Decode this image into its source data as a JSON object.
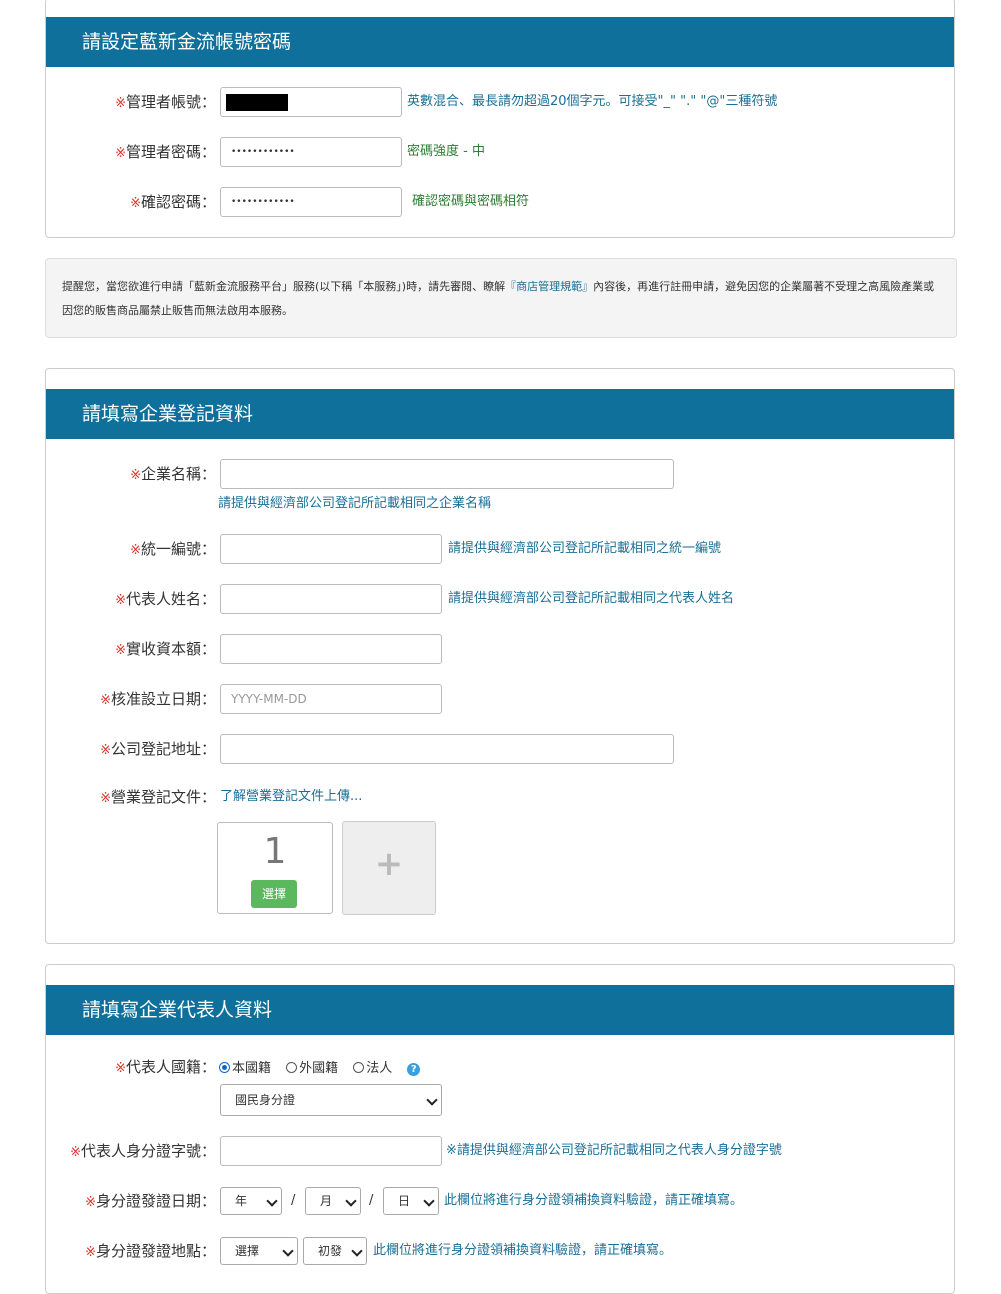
{
  "account_section": {
    "title": "請設定藍新金流帳號密碼",
    "admin_account": {
      "label": "管理者帳號：",
      "hint": "英數混合、最長請勿超過20個字元。可接受\"_\" \".\" \"@\"三種符號"
    },
    "admin_password": {
      "label": "管理者密碼：",
      "value": "••••••••••••",
      "strength": "密碼強度 - 中"
    },
    "confirm_password": {
      "label": "確認密碼：",
      "value": "••••••••••••",
      "match": "確認密碼與密碼相符"
    }
  },
  "notice": {
    "text_before": "提醒您，當您欲進行申請「藍新金流服務平台」服務(以下稱「本服務」)時，請先審閱、瞭解",
    "link": "『商店管理規範』",
    "text_after": "內容後，再進行註冊申請，避免因您的企業屬著不受理之高風險產業或因您的販售商品屬禁止販售而無法啟用本服務。"
  },
  "company_section": {
    "title": "請填寫企業登記資料",
    "company_name": {
      "label": "企業名稱：",
      "hint": "請提供與經濟部公司登記所記載相同之企業名稱"
    },
    "tax_id": {
      "label": "統一編號：",
      "hint": "請提供與經濟部公司登記所記載相同之統一編號"
    },
    "rep_name": {
      "label": "代表人姓名：",
      "hint": "請提供與經濟部公司登記所記載相同之代表人姓名"
    },
    "capital": {
      "label": "實收資本額："
    },
    "est_date": {
      "label": "核准設立日期：",
      "placeholder": "YYYY-MM-DD"
    },
    "address": {
      "label": "公司登記地址："
    },
    "business_doc": {
      "label": "營業登記文件：",
      "link": "了解營業登記文件上傳..."
    },
    "upload_slot": {
      "number": "1",
      "button": "選擇",
      "add": "+"
    }
  },
  "rep_section": {
    "title": "請填寫企業代表人資料",
    "nationality": {
      "label": "代表人國籍：",
      "options": [
        "本國籍",
        "外國籍",
        "法人"
      ],
      "selected": "本國籍"
    },
    "id_type": {
      "value": "國民身分證"
    },
    "id_number": {
      "label": "代表人身分證字號：",
      "hint": "※請提供與經濟部公司登記所記載相同之代表人身分證字號"
    },
    "issue_date": {
      "label": "身分證發證日期：",
      "year": "年",
      "month": "月",
      "day": "日",
      "sep": "/",
      "hint": "此欄位將進行身分證領補換資料驗證，請正確填寫。"
    },
    "issue_place": {
      "label": "身分證發證地點：",
      "place": "選擇",
      "type": "初發",
      "hint": "此欄位將進行身分證領補換資料驗證，請正確填寫。"
    }
  },
  "required_mark": "※",
  "colors": {
    "header_blue": "#0f719b",
    "required_red": "#e0302a",
    "hint_blue": "#1a6f95",
    "hint_green": "#2e7d32",
    "button_green": "#5cb85c"
  }
}
